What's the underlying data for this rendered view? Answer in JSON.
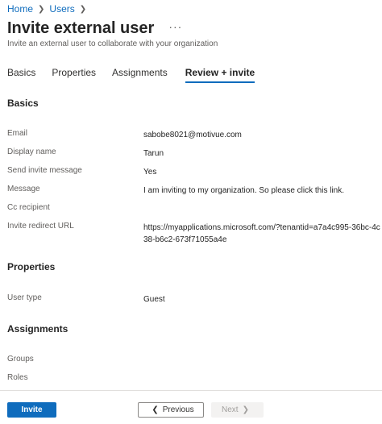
{
  "breadcrumb": {
    "home": "Home",
    "users": "Users"
  },
  "header": {
    "title": "Invite external user",
    "more": "···",
    "subtitle": "Invite an external user to collaborate with your organization"
  },
  "tabs": [
    "Basics",
    "Properties",
    "Assignments",
    "Review + invite"
  ],
  "sections": {
    "basics": {
      "title": "Basics",
      "rows": [
        {
          "label": "Email",
          "value": "sabobe8021@motivue.com"
        },
        {
          "label": "Display name",
          "value": "Tarun"
        },
        {
          "label": "Send invite message",
          "value": "Yes"
        },
        {
          "label": "Message",
          "value": "I am inviting to my organization. So please click this link."
        },
        {
          "label": "Cc recipient",
          "value": ""
        },
        {
          "label": "Invite redirect URL",
          "value": "https://myapplications.microsoft.com/?tenantid=a7a4c995-36bc-4c38-b6c2-673f71055a4e"
        }
      ]
    },
    "properties": {
      "title": "Properties",
      "rows": [
        {
          "label": "User type",
          "value": "Guest"
        }
      ]
    },
    "assignments": {
      "title": "Assignments",
      "rows": [
        {
          "label": "Groups",
          "value": ""
        },
        {
          "label": "Roles",
          "value": ""
        }
      ]
    }
  },
  "footer": {
    "invite": "Invite",
    "previous": "Previous",
    "next": "Next"
  },
  "colors": {
    "accent": "#0f6cbd"
  }
}
